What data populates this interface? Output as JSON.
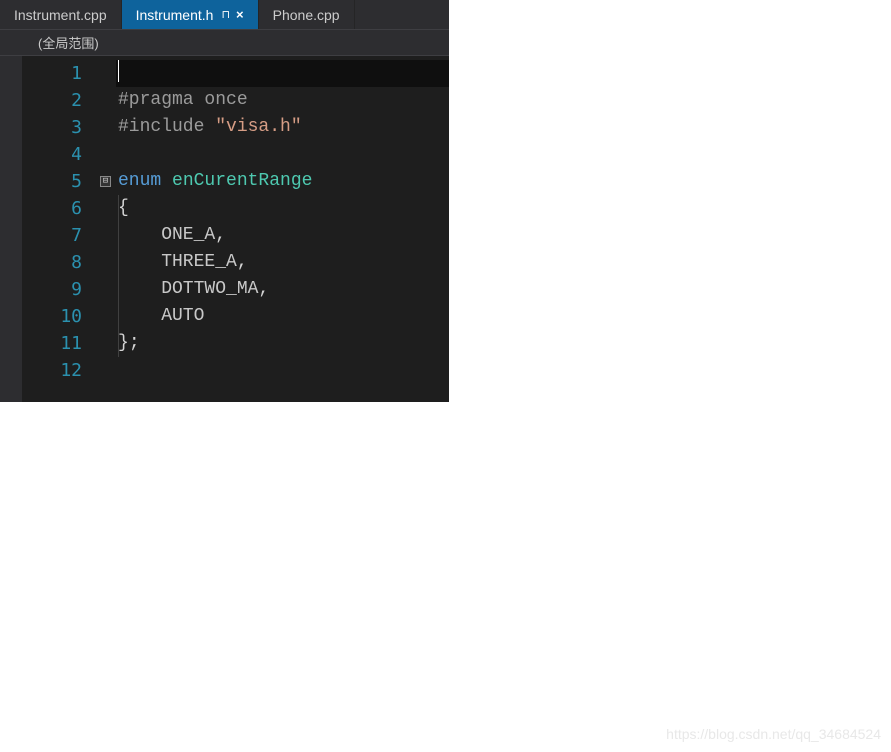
{
  "tabs": [
    {
      "label": "Instrument.cpp",
      "active": false
    },
    {
      "label": "Instrument.h",
      "active": true
    },
    {
      "label": "Phone.cpp",
      "active": false
    }
  ],
  "pin_glyph": "⊓",
  "close_glyph": "×",
  "scope": "(全局范围)",
  "fold_glyph": "⊟",
  "line_numbers": [
    "1",
    "2",
    "3",
    "4",
    "5",
    "6",
    "7",
    "8",
    "9",
    "10",
    "11",
    "12"
  ],
  "code": {
    "l2_pragma": "#pragma",
    "l2_once": " once",
    "l3_include": "#include",
    "l3_string": " \"visa.h\"",
    "l5_enum": "enum",
    "l5_type": " enCurentRange",
    "l6_brace": "{",
    "l7_id": "    ONE_A",
    "l7_p": ",",
    "l8_id": "    THREE_A",
    "l8_p": ",",
    "l9_id": "    DOTTWO_MA",
    "l9_p": ",",
    "l10_id": "    AUTO",
    "l11_brace": "}",
    "l11_semi": ";"
  },
  "watermark": "https://blog.csdn.net/qq_34684524"
}
